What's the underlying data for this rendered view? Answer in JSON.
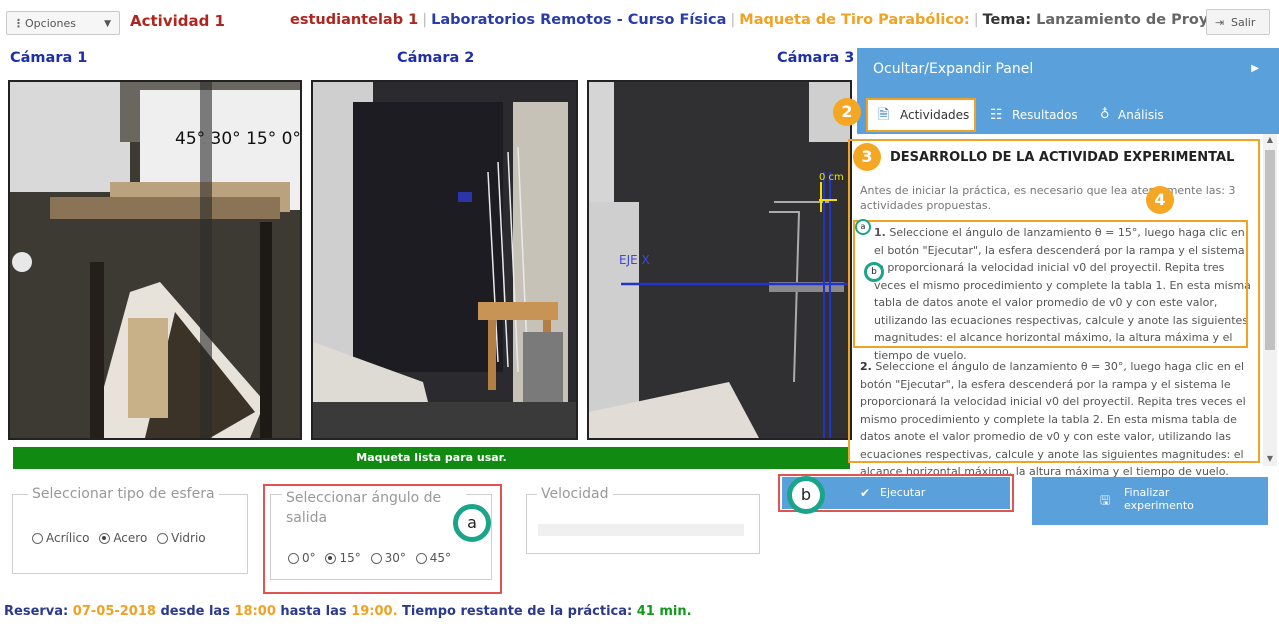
{
  "header": {
    "options_label": "Opciones",
    "activity_title": "Actividad 1",
    "user": "estudiantelab 1",
    "separator": "|",
    "lab": "Laboratorios Remotos - Curso Física",
    "maqueta": "Maqueta de Tiro Parabólico:",
    "tema_label": "Tema:",
    "tema_value": "Lanzamiento de Proyectil",
    "salir_label": "Salir"
  },
  "cameras": [
    {
      "label": "Cámara 1"
    },
    {
      "label": "Cámara 2"
    },
    {
      "label": "Cámara 3"
    }
  ],
  "camera_overlays": {
    "cam1_angles": "45° 30° 15° 0°",
    "cam3_axis": "EJE X",
    "cam3_scale": "0 cm"
  },
  "status_message": "Maqueta lista para usar.",
  "panel": {
    "toggle_label": "Ocultar/Expandir Panel",
    "tabs": [
      {
        "label": "Actividades",
        "active": true
      },
      {
        "label": "Resultados",
        "active": false
      },
      {
        "label": "Análisis",
        "active": false
      }
    ],
    "heading": "DESARROLLO DE LA ACTIVIDAD EXPERIMENTAL",
    "intro": "Antes de iniciar la práctica, es necesario que lea atentamente las: 3 actividades propuestas.",
    "items": [
      {
        "number": "1.",
        "text": "Seleccione el ángulo de lanzamiento θ = 15°, luego haga clic en el botón \"Ejecutar\", la esfera descenderá por la rampa y el sistema le proporcionará la velocidad inicial v0 del proyectil. Repita tres veces el mismo procedimiento y complete la tabla 1. En esta misma tabla de datos anote el valor promedio de v0 y con este valor, utilizando las ecuaciones respectivas, calcule y anote las siguientes magnitudes: el alcance horizontal máximo, la altura máxima y el tiempo de vuelo."
      },
      {
        "number": "2.",
        "text": "Seleccione el ángulo de lanzamiento θ = 30°, luego haga clic en el botón \"Ejecutar\", la esfera descenderá por la rampa y el sistema le proporcionará la velocidad inicial v0 del proyectil. Repita tres veces el mismo procedimiento y complete la tabla 2. En esta misma tabla de datos anote el valor promedio de v0 y con este valor, utilizando las ecuaciones respectivas, calcule y anote las siguientes magnitudes: el alcance horizontal máximo, la altura máxima y el tiempo de vuelo."
      }
    ]
  },
  "badges": {
    "tabs": "2",
    "heading": "3",
    "item": "4",
    "small_a": "a",
    "small_b": "b",
    "big_a": "a",
    "big_b": "b"
  },
  "controls": {
    "esfera": {
      "legend": "Seleccionar tipo de esfera",
      "options": [
        "Acrílico",
        "Acero",
        "Vidrio"
      ],
      "selected": "Acero"
    },
    "angulo": {
      "legend": "Seleccionar ángulo de salida",
      "options": [
        "0°",
        "15°",
        "30°",
        "45°"
      ],
      "selected": "15°"
    },
    "velocidad": {
      "legend": "Velocidad",
      "value": ""
    },
    "ejecutar_label": "Ejecutar",
    "finalizar_label": "Finalizar experimento"
  },
  "reserva": {
    "label": "Reserva:",
    "date": "07-05-2018",
    "desde": "desde las",
    "start": "18:00",
    "hasta": "hasta las",
    "end": "19:00.",
    "tiempo_label": "Tiempo restante de la práctica:",
    "tiempo_value": "41 min."
  },
  "colors": {
    "accent_blue": "#5aa0da",
    "status_green": "#108a10",
    "highlight_orange": "#f0a224",
    "annotation_red": "#e05353",
    "annotation_green": "#1aa58b"
  }
}
